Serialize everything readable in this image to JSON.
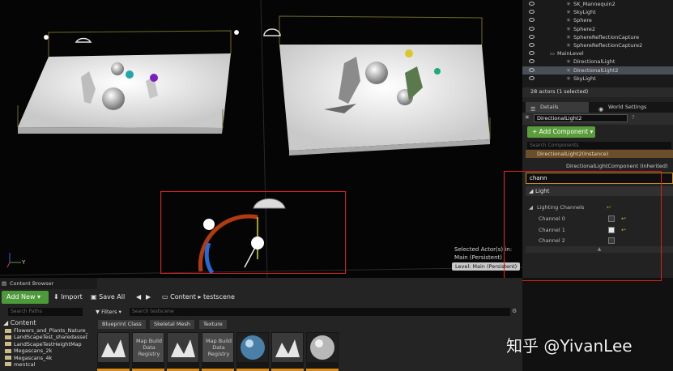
{
  "viewport": {
    "selected_actors": "Selected Actor(s) in:",
    "level_main": "Main (Persistent)",
    "level_badge": "Level:  Main (Persistent)",
    "axis_label": "Y"
  },
  "outliner": {
    "rows": [
      {
        "label": "SK_Mannequin2",
        "selected": false
      },
      {
        "label": "SkyLight",
        "selected": false
      },
      {
        "label": "Sphere",
        "selected": false
      },
      {
        "label": "Sphere2",
        "selected": false
      },
      {
        "label": "SphereReflectionCapture",
        "selected": false
      },
      {
        "label": "SphereReflectionCapture2",
        "selected": false
      },
      {
        "label": "MainLevel",
        "selected": false,
        "folder": true
      },
      {
        "label": "DirectionalLight",
        "selected": false
      },
      {
        "label": "DirectionalLight2",
        "selected": true
      },
      {
        "label": "SkyLight",
        "selected": false
      }
    ],
    "actor_count": "28 actors (1 selected)"
  },
  "details": {
    "tab_details": "Details",
    "tab_world": "World Settings",
    "name_value": "DirectionalLight2",
    "add_component": "+ Add Component ▾",
    "search_components": "Search Components",
    "instance_row": "DirectionalLight2(Instance)",
    "inherited_row": "DirectionalLightComponent (Inherited)",
    "search_value": "chann",
    "category": "Light",
    "sub_category": "Lighting Channels",
    "channels": [
      {
        "label": "Channel 0",
        "checked": false
      },
      {
        "label": "Channel 1",
        "checked": true
      },
      {
        "label": "Channel 2",
        "checked": false
      }
    ]
  },
  "content_browser": {
    "tab": "Content Browser",
    "add_new": "Add New ▾",
    "import": "Import",
    "save_all": "Save All",
    "crumb_content": "Content",
    "crumb_sep": "▸",
    "crumb_folder": "testscene",
    "search_paths": "Search Paths",
    "filters": "▼ Filters ▾",
    "search_scene": "Search testscene",
    "chips": [
      "Blueprint Class",
      "Skeletal Mesh",
      "Texture"
    ],
    "tree": {
      "root": "Content",
      "folders": [
        "Flowers_and_Plants_Nature_",
        "LandScapeTest_sharedasset",
        "LandScapeTestHeightMap",
        "Megascans_2k",
        "Megascans_4k",
        "mentcal"
      ]
    },
    "asset_label": "Map Build Data Registry"
  },
  "watermark": "知乎 @YivanLee",
  "colors": {
    "accent_green": "#5a9e3b",
    "selection_box": "#e02020",
    "instance_orange": "#6b4f2c",
    "asset_strip": "#d98c1e"
  }
}
